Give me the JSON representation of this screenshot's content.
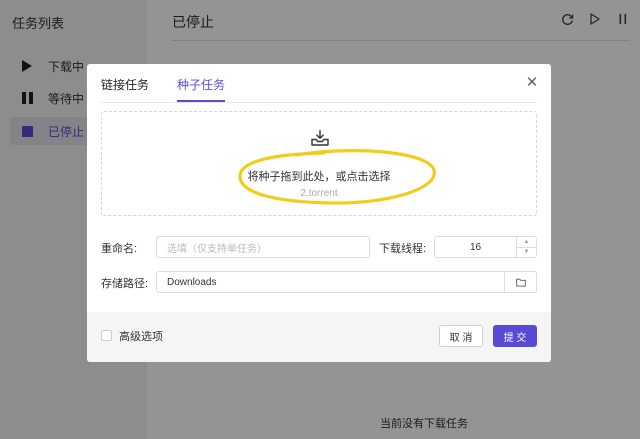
{
  "sidebar": {
    "title": "任务列表",
    "items": [
      {
        "label": "下载中",
        "icon": "play-icon"
      },
      {
        "label": "等待中",
        "icon": "pause-icon"
      },
      {
        "label": "已停止",
        "icon": "stop-icon"
      }
    ]
  },
  "main": {
    "title": "已停止",
    "empty_text": "当前没有下载任务"
  },
  "dialog": {
    "tabs": [
      "链接任务",
      "种子任务"
    ],
    "active_tab": "种子任务",
    "drop_text": "将种子拖到此处，或点击选择",
    "drop_hint": "2.torrent",
    "rename_label": "重命名:",
    "rename_placeholder": "选填（仅支持单任务）",
    "threads_label": "下载线程:",
    "threads_value": "16",
    "path_label": "存储路径:",
    "path_value": "Downloads",
    "advanced_label": "高级选项",
    "cancel_label": "取 消",
    "submit_label": "提 交"
  },
  "colors": {
    "accent": "#5a4bd6",
    "highlight": "#f2cc1b"
  }
}
